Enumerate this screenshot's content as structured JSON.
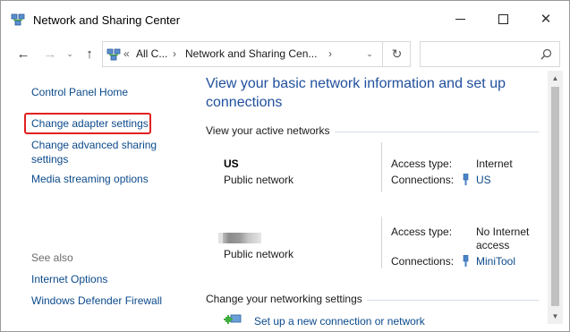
{
  "window": {
    "title": "Network and Sharing Center",
    "icon": "network-sharing-center-icon"
  },
  "title_buttons": {
    "minimize": "minimize-icon",
    "maximize": "maximize-icon",
    "close": "✕"
  },
  "nav": {
    "back": "←",
    "forward": "→",
    "recent": "⌄",
    "up": "↑"
  },
  "address": {
    "chevron_lead": "«",
    "crumb1": "All C...",
    "chevron_sep": "›",
    "crumb2": "Network and Sharing Cen...",
    "chevron_end": "›",
    "refresh": "↻"
  },
  "search": {
    "placeholder": ""
  },
  "sidebar": {
    "items": [
      {
        "label": "Control Panel Home"
      },
      {
        "label": "Change adapter settings"
      },
      {
        "label_line1": "Change advanced sharing",
        "label_line2": "settings"
      },
      {
        "label": "Media streaming options"
      }
    ],
    "see_also_label": "See also",
    "see_also": [
      {
        "label": "Internet Options"
      },
      {
        "label": "Windows Defender Firewall"
      }
    ]
  },
  "main": {
    "heading": "View your basic network information and set up connections",
    "active_networks_title": "View your active networks",
    "networks": [
      {
        "name": "US",
        "type": "Public network",
        "access_type_label": "Access type:",
        "access_type_value": "Internet",
        "connections_label": "Connections:",
        "connection": "US"
      },
      {
        "name": "",
        "type": "Public network",
        "access_type_label": "Access type:",
        "access_type_value_line1": "No Internet",
        "access_type_value_line2": "access",
        "connections_label": "Connections:",
        "connection": "MiniTool"
      }
    ],
    "change_settings_title": "Change your networking settings",
    "setup_link": "Set up a new connection or network"
  },
  "colors": {
    "link": "#0b4a8b",
    "heading": "#1f4f9c",
    "highlight": "#e0201f"
  }
}
